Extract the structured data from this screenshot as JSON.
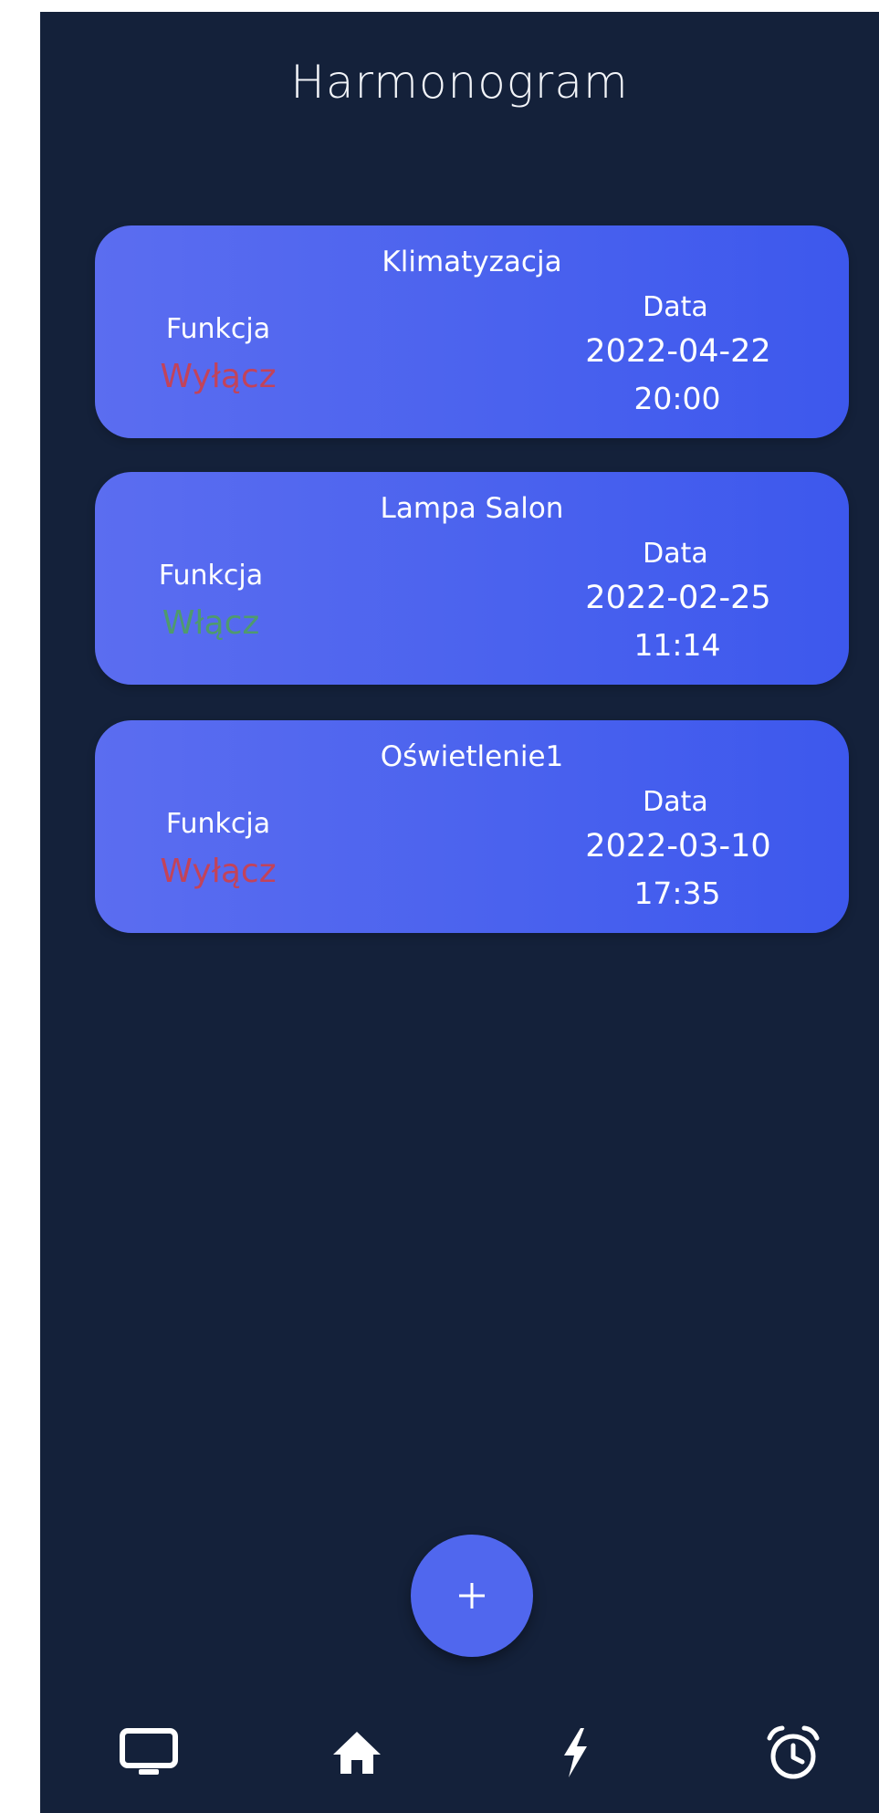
{
  "header": {
    "title": "Harmonogram"
  },
  "schedule": [
    {
      "device": "Klimatyzacja",
      "function_label": "Funkcja",
      "function_value": "Wyłącz",
      "function_color": "#c2435a",
      "date_label": "Data",
      "date": "2022-04-22",
      "time": "20:00"
    },
    {
      "device": "Lampa Salon",
      "function_label": "Funkcja",
      "function_value": "Włącz",
      "function_color": "#4f9a6e",
      "date_label": "Data",
      "date": "2022-02-25",
      "time": "11:14"
    },
    {
      "device": "Oświetlenie1",
      "function_label": "Funkcja",
      "function_value": "Wyłącz",
      "function_color": "#c2435a",
      "date_label": "Data",
      "date": "2022-03-10",
      "time": "17:35"
    }
  ],
  "fab": {
    "icon": "plus-icon"
  },
  "nav": [
    {
      "icon": "monitor-icon"
    },
    {
      "icon": "home-icon"
    },
    {
      "icon": "lightning-icon"
    },
    {
      "icon": "alarm-clock-icon"
    }
  ],
  "colors": {
    "background": "#14213a",
    "card_start": "#5b6df0",
    "card_end": "#3d58ed",
    "fab": "#5067ee",
    "off": "#c2435a",
    "on": "#4f9a6e"
  }
}
